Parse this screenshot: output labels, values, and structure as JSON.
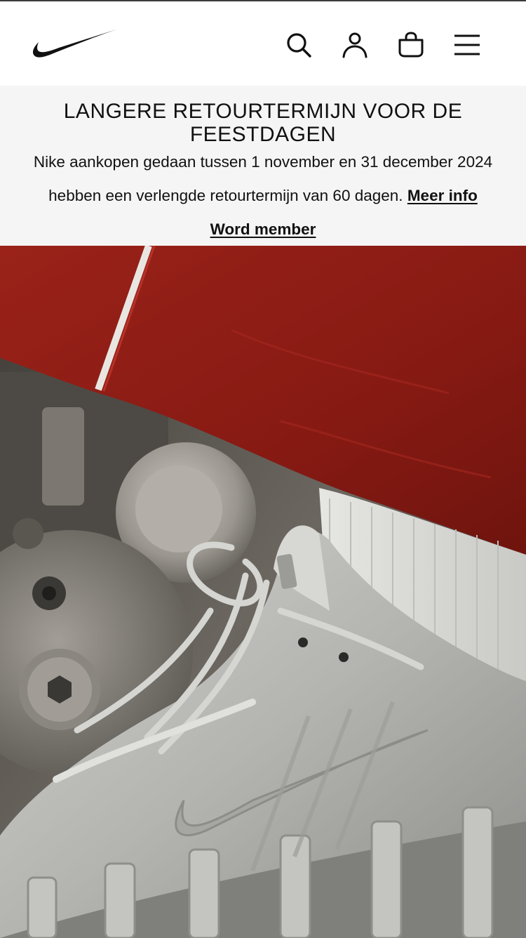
{
  "header": {
    "logo_name": "nike-swoosh-logo",
    "icons": [
      "search-icon",
      "account-icon",
      "bag-icon",
      "menu-icon"
    ]
  },
  "promo": {
    "title": "LANGERE RETOURTERMIJN VOOR DE FEESTDAGEN",
    "line1": "Nike aankopen gedaan tussen 1 november en 31 december 2024",
    "line2": "hebben een verlengde retourtermijn van 60 dagen.",
    "more_info_link": "Meer info",
    "member_link": "Word member",
    "background_color": "#f5f5f5"
  },
  "hero": {
    "description_icon": "hero-image",
    "colors": {
      "fabric_red": "#8f1c15",
      "sneaker_silver": "#b9b9b6",
      "engine_metal": "#6e6b66"
    }
  }
}
